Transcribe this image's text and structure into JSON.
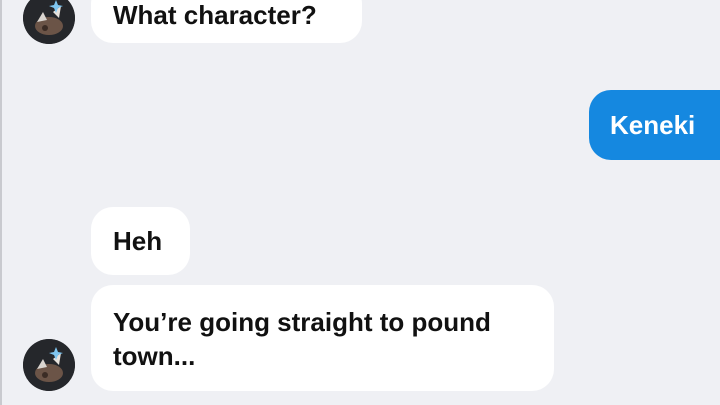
{
  "chat": {
    "messages": [
      {
        "sender": "them",
        "text": "What character?"
      },
      {
        "sender": "me",
        "text": "Keneki"
      },
      {
        "sender": "them",
        "text": "Heh"
      },
      {
        "sender": "them",
        "line1": "You’re going straight to pound",
        "line2": "town..."
      }
    ]
  },
  "colors": {
    "background": "#eff0f4",
    "incoming_bubble": "#ffffff",
    "outgoing_bubble": "#1588e0"
  },
  "icons": {
    "avatar": "character-avatar-icon"
  }
}
